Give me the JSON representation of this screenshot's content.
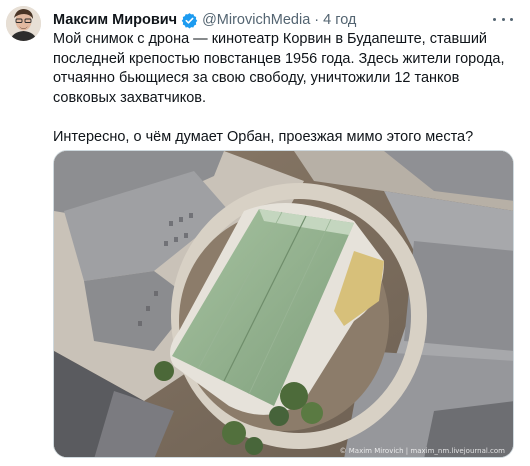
{
  "tweet": {
    "author_name": "Максим Мирович",
    "handle": "@MirovichMedia",
    "separator": "·",
    "time": "4 год",
    "paragraphs": [
      "Мой снимок с дрона — кинотеатр Корвин в Будапеште, ставший последней крепостью повстанцев 1956 года. Здесь жители города, отчаянно бьющиеся за свою свободу, уничтожили 12 танков совковых захватчиков.",
      "Интересно, о чём думает Орбан, проезжая мимо этого места?"
    ],
    "media": {
      "watermark": "© Maxim Mirovich | maxim_nm.livejournal.com"
    }
  },
  "colors": {
    "verified_badge": "#1d9bf0",
    "roof_green": "#8fae8a",
    "text_secondary": "#536471"
  },
  "icons": {
    "verified": "verified-badge-icon",
    "more": "more-dots-icon"
  }
}
